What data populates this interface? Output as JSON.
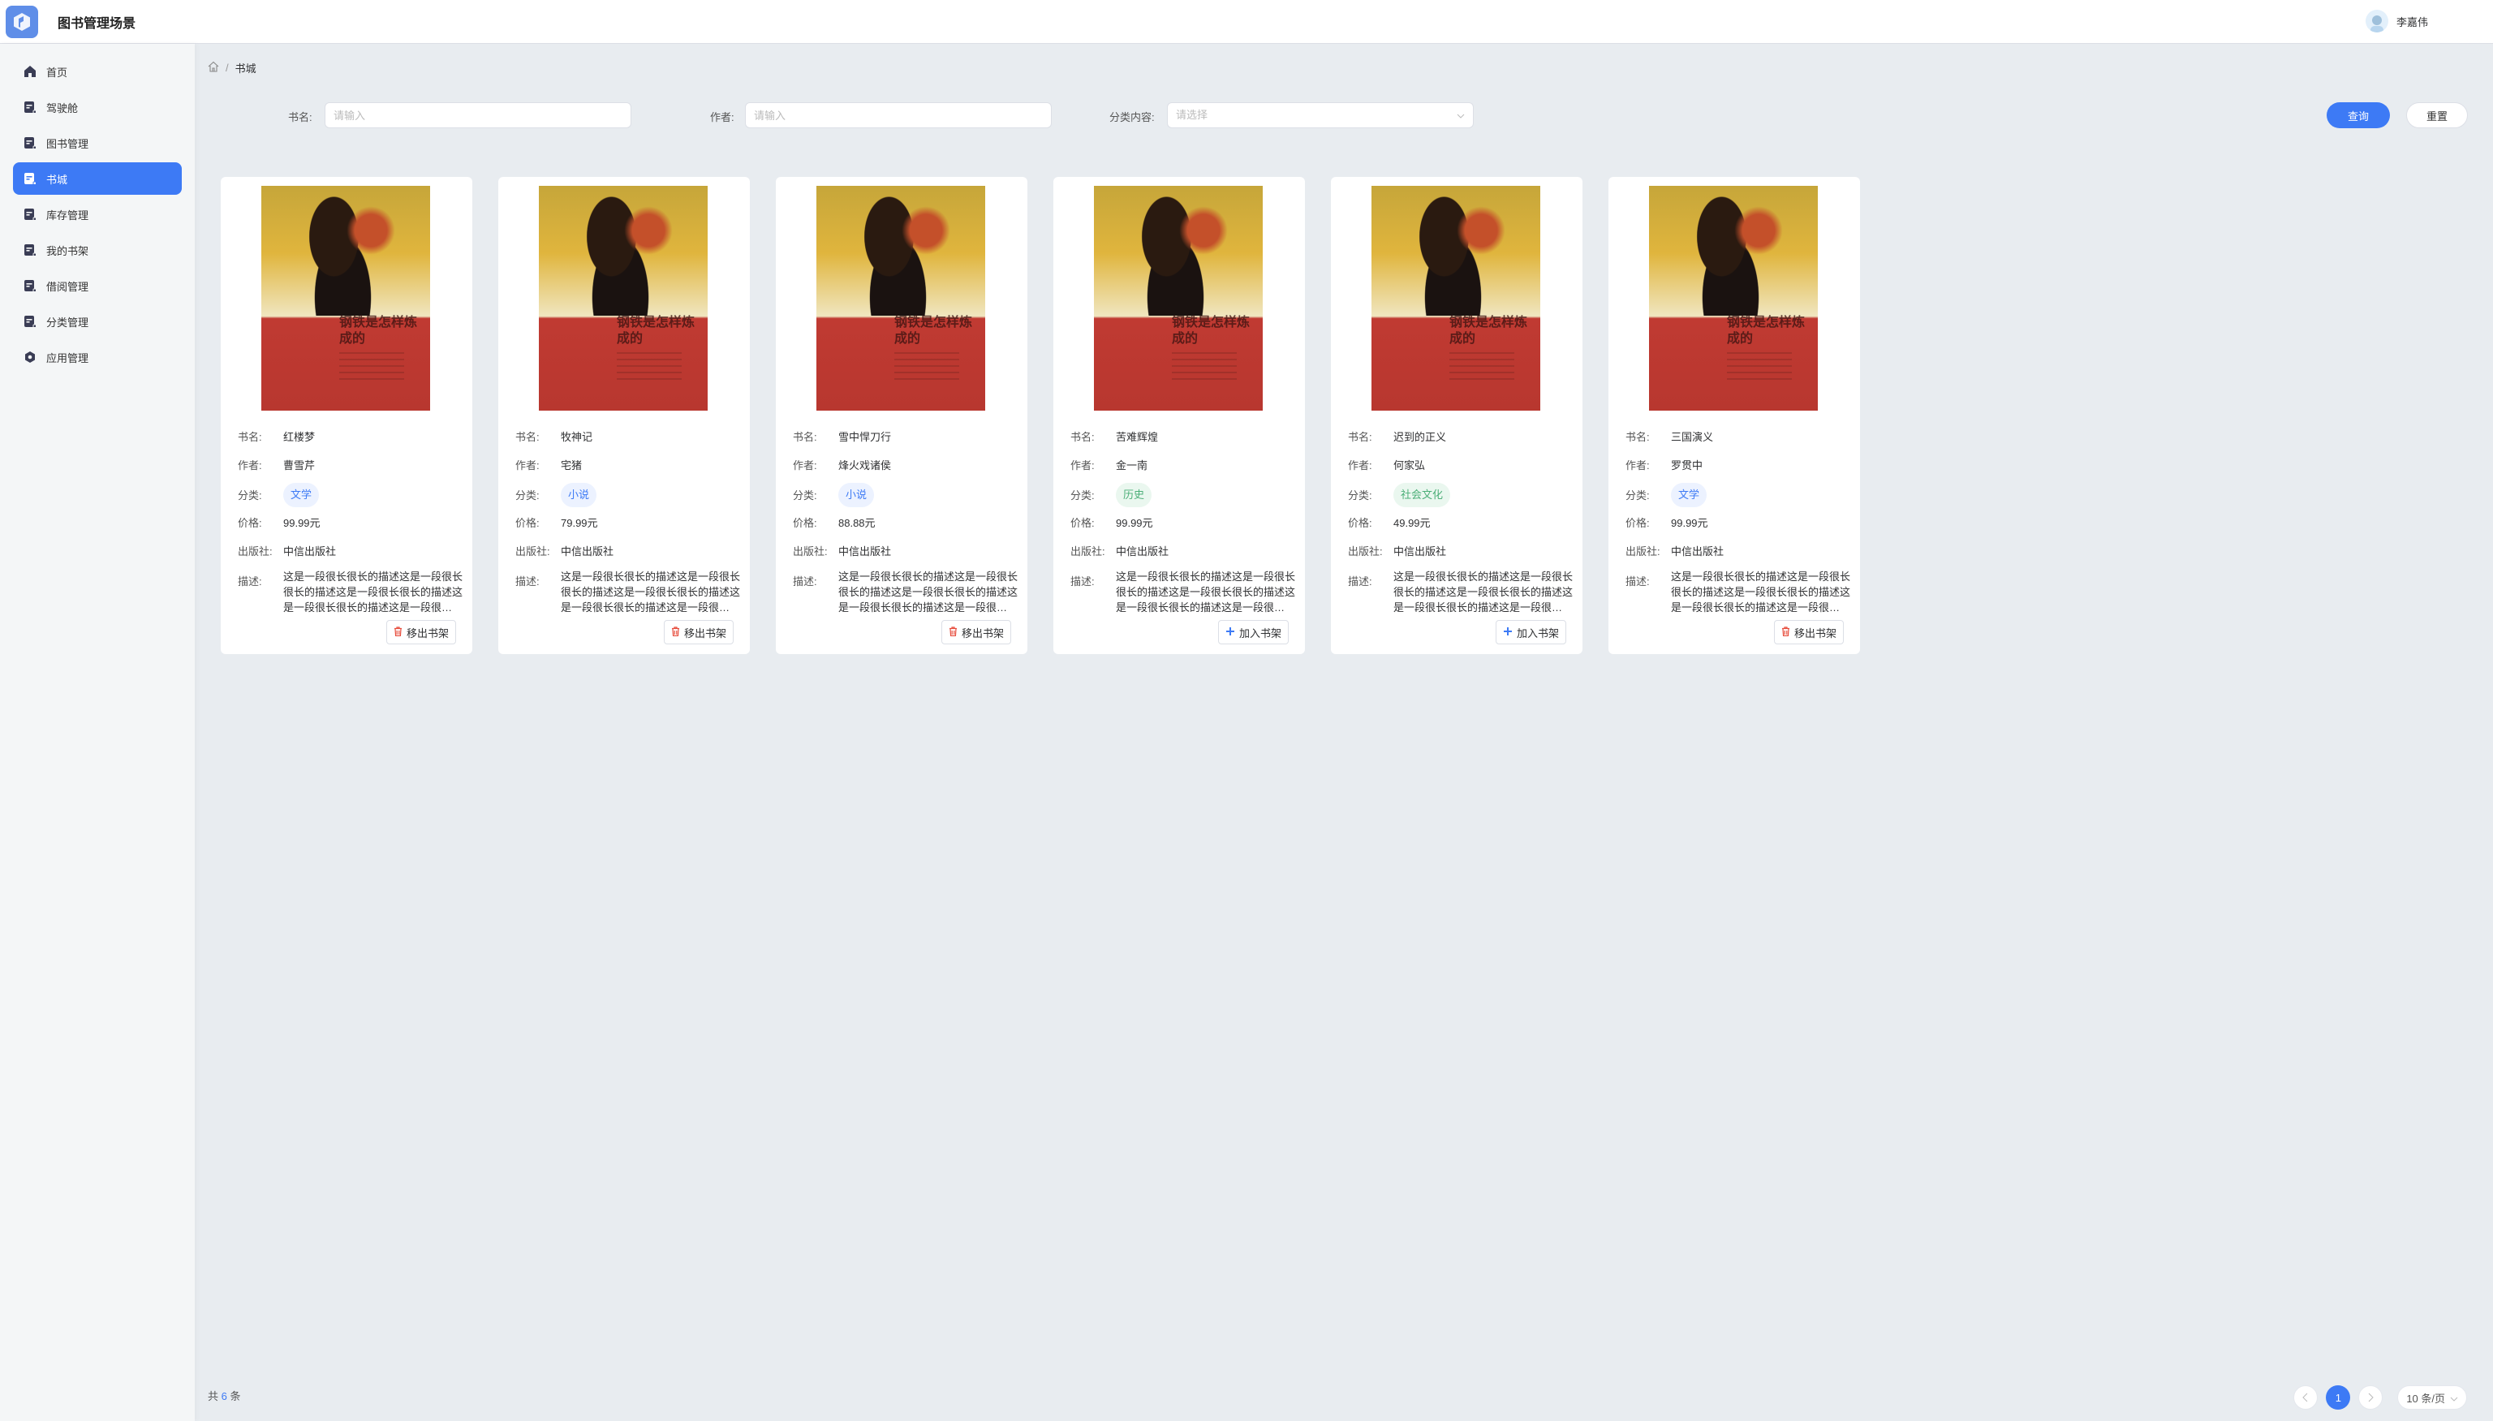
{
  "header": {
    "title": "图书管理场景",
    "user": "李嘉伟"
  },
  "colors": {
    "primary": "#3d7af5",
    "tag_blue_bg": "#ecf2ff",
    "tag_blue_fg": "#3d7af5",
    "tag_green_bg": "#eaf7ef",
    "tag_green_fg": "#4caf78",
    "danger": "#e74c3c"
  },
  "sidebar": {
    "items": [
      {
        "label": "首页",
        "icon": "home-icon"
      },
      {
        "label": "驾驶舱",
        "icon": "document-icon"
      },
      {
        "label": "图书管理",
        "icon": "document-icon"
      },
      {
        "label": "书城",
        "icon": "document-icon",
        "active": true
      },
      {
        "label": "库存管理",
        "icon": "document-icon"
      },
      {
        "label": "我的书架",
        "icon": "document-icon"
      },
      {
        "label": "借阅管理",
        "icon": "document-icon"
      },
      {
        "label": "分类管理",
        "icon": "document-icon"
      },
      {
        "label": "应用管理",
        "icon": "gear-icon"
      }
    ]
  },
  "breadcrumb": {
    "current": "书城"
  },
  "search": {
    "name_label": "书名:",
    "name_placeholder": "请输入",
    "author_label": "作者:",
    "author_placeholder": "请输入",
    "category_label": "分类内容:",
    "category_placeholder": "请选择",
    "query": "查询",
    "reset": "重置"
  },
  "labels": {
    "name": "书名:",
    "author": "作者:",
    "category": "分类:",
    "price": "价格:",
    "publisher": "出版社:",
    "desc": "描述:"
  },
  "books": [
    {
      "name": "红楼梦",
      "author": "曹雪芹",
      "category": "文学",
      "tag": "blue",
      "price": "99.99元",
      "publisher": "中信出版社",
      "desc": "这是一段很长很长的描述这是一段很长很长的描述这是一段很长很长的描述这是一段很长很长的描述这是一段很长很长的描述",
      "action": "移出书架",
      "action_type": "remove",
      "cover_title": "钢铁是怎样炼成的"
    },
    {
      "name": "牧神记",
      "author": "宅猪",
      "category": "小说",
      "tag": "blue",
      "price": "79.99元",
      "publisher": "中信出版社",
      "desc": "这是一段很长很长的描述这是一段很长很长的描述这是一段很长很长的描述这是一段很长很长的描述这是一段很长很长的描述",
      "action": "移出书架",
      "action_type": "remove",
      "cover_title": "钢铁是怎样炼成的"
    },
    {
      "name": "雪中悍刀行",
      "author": "烽火戏诸侯",
      "category": "小说",
      "tag": "blue",
      "price": "88.88元",
      "publisher": "中信出版社",
      "desc": "这是一段很长很长的描述这是一段很长很长的描述这是一段很长很长的描述这是一段很长很长的描述这是一段很长很长的描述",
      "action": "移出书架",
      "action_type": "remove",
      "cover_title": "钢铁是怎样炼成的"
    },
    {
      "name": "苦难辉煌",
      "author": "金一南",
      "category": "历史",
      "tag": "green",
      "price": "99.99元",
      "publisher": "中信出版社",
      "desc": "这是一段很长很长的描述这是一段很长很长的描述这是一段很长很长的描述这是一段很长很长的描述这是一段很长很长的描述",
      "action": "加入书架",
      "action_type": "add",
      "cover_title": "钢铁是怎样炼成的"
    },
    {
      "name": "迟到的正义",
      "author": "何家弘",
      "category": "社会文化",
      "tag": "green",
      "price": "49.99元",
      "publisher": "中信出版社",
      "desc": "这是一段很长很长的描述这是一段很长很长的描述这是一段很长很长的描述这是一段很长很长的描述这是一段很长很长的描述",
      "action": "加入书架",
      "action_type": "add",
      "cover_title": "钢铁是怎样炼成的"
    },
    {
      "name": "三国演义",
      "author": "罗贯中",
      "category": "文学",
      "tag": "blue",
      "price": "99.99元",
      "publisher": "中信出版社",
      "desc": "这是一段很长很长的描述这是一段很长很长的描述这是一段很长很长的描述这是一段很长很长的描述这是一段很长很长的描述",
      "action": "移出书架",
      "action_type": "remove",
      "cover_title": "钢铁是怎样炼成的"
    }
  ],
  "footer": {
    "total_prefix": "共",
    "total": "6",
    "total_suffix": "条",
    "page": "1",
    "page_size": "10 条/页"
  }
}
